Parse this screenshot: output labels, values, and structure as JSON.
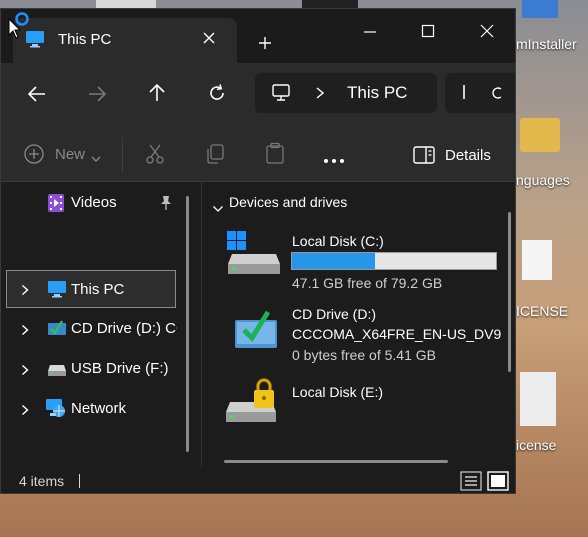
{
  "desktop": {
    "right_labels": [
      "mInstaller",
      "nguages",
      "ICENSE",
      "icense"
    ]
  },
  "window": {
    "tab_title": "This PC",
    "address_path": "This PC"
  },
  "toolbar": {
    "new_label": "New",
    "details_label": "Details"
  },
  "nav": {
    "items": [
      {
        "label": "Videos"
      },
      {
        "label": "This PC"
      },
      {
        "label": "CD Drive (D:) CC"
      },
      {
        "label": "USB Drive (F:)"
      },
      {
        "label": "Network"
      }
    ]
  },
  "content": {
    "group_label": "Devices and drives",
    "drives": [
      {
        "name": "Local Disk (C:)",
        "free_text": "47.1 GB free of 79.2 GB",
        "used_fraction": 0.405
      },
      {
        "name": "CD Drive (D:)",
        "volume": "CCCOMA_X64FRE_EN-US_DV9",
        "free_text": "0 bytes free of 5.41 GB"
      },
      {
        "name": "Local Disk (E:)"
      }
    ]
  },
  "status": {
    "items_text": "4 items"
  },
  "colors": {
    "accent": "#1f8fe6",
    "window_bg": "#1f1f1f",
    "selected_bg": "#2d2d2d"
  }
}
